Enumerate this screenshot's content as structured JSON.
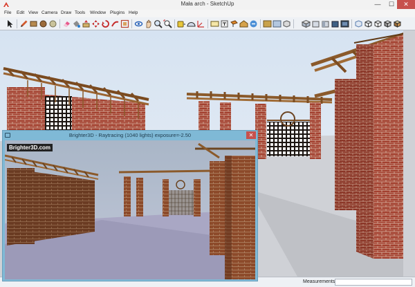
{
  "window": {
    "title": "Mała arch - SketchUp",
    "minimize": "—",
    "maximize": "☐",
    "close": "✕"
  },
  "menu": [
    "File",
    "Edit",
    "View",
    "Camera",
    "Draw",
    "Tools",
    "Window",
    "Plugins",
    "Help"
  ],
  "toolbar": {
    "tools": [
      "select-icon",
      "pencil-icon",
      "rectangle-icon",
      "circle-icon",
      "polygon-icon",
      "eraser-icon",
      "paint-bucket-icon",
      "push-pull-icon",
      "move-icon",
      "rotate-icon",
      "follow-me-icon",
      "offset-icon",
      "orbit-icon",
      "pan-icon",
      "zoom-icon",
      "zoom-extents-icon",
      "tape-measure-icon",
      "protractor-icon",
      "axes-icon",
      "dimension-icon",
      "text-icon",
      "section-plane-icon",
      "3d-warehouse-icon",
      "components-icon",
      "extension-icon",
      "share-model-icon",
      "iso-view-icon",
      "top-view-icon",
      "front-view-icon",
      "right-view-icon",
      "back-view-icon",
      "left-view-icon",
      "xray-icon",
      "wireframe-icon",
      "hidden-line-icon",
      "shaded-icon",
      "shaded-textures-icon"
    ]
  },
  "statusbar": {
    "measurements_label": "Measurements",
    "measurements_value": ""
  },
  "render_window": {
    "title": "Brighter3D - Raytracing (1040 lights) exposure=-2.50",
    "brand": "Brighter3D.com",
    "close": "✕"
  }
}
